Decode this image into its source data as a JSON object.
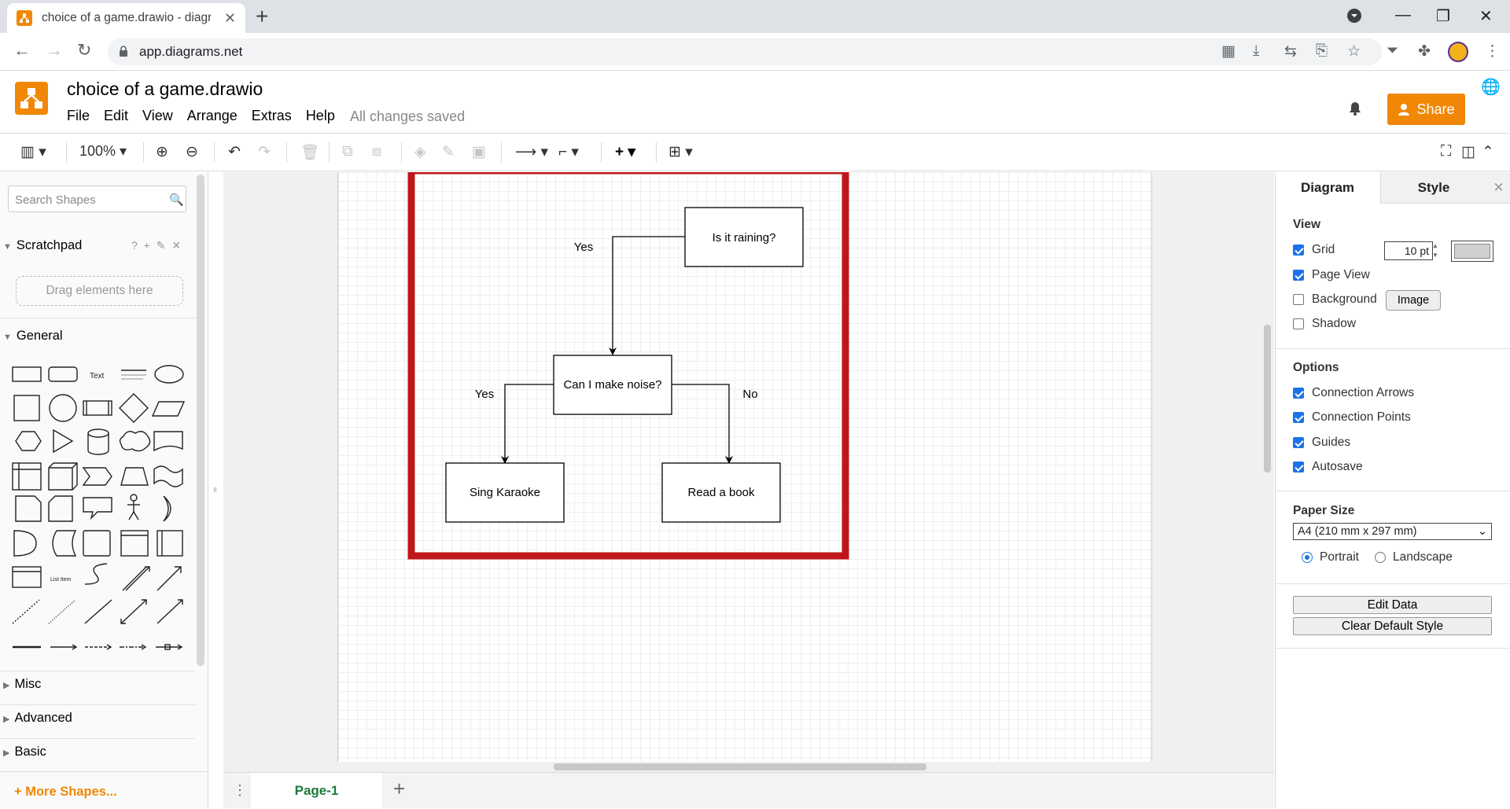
{
  "browser": {
    "tab_title": "choice of a game.drawio - diagra",
    "url": "app.diagrams.net"
  },
  "app": {
    "doc_title": "choice of a game.drawio",
    "menu": [
      "File",
      "Edit",
      "View",
      "Arrange",
      "Extras",
      "Help"
    ],
    "status": "All changes saved",
    "share_label": "Share",
    "accent_color": "#f08705"
  },
  "toolbar": {
    "zoom": "100%"
  },
  "left_panel": {
    "search_placeholder": "Search Shapes",
    "scratchpad": "Scratchpad",
    "scratchpad_tools": "? + ✎ ✕",
    "drag_hint": "Drag elements here",
    "general": "General",
    "misc": "Misc",
    "advanced": "Advanced",
    "basic": "Basic",
    "more_shapes": "+ More Shapes..."
  },
  "diagram": {
    "nodes": [
      {
        "id": "q1",
        "label": "Is it raining?"
      },
      {
        "id": "q2",
        "label": "Can I make noise?"
      },
      {
        "id": "a1",
        "label": "Sing Karaoke"
      },
      {
        "id": "a2",
        "label": "Read a book"
      }
    ],
    "edges": [
      {
        "from": "q1",
        "to": "q2",
        "label": "Yes"
      },
      {
        "from": "q2",
        "to": "a1",
        "label": "Yes"
      },
      {
        "from": "q2",
        "to": "a2",
        "label": "No"
      }
    ],
    "highlight_color": "#c0161b"
  },
  "page_tabs": [
    "Page-1"
  ],
  "right_panel": {
    "tabs": [
      "Diagram",
      "Style"
    ],
    "view_title": "View",
    "grid_label": "Grid",
    "grid_size": "10 pt",
    "page_view_label": "Page View",
    "background_label": "Background",
    "image_button": "Image",
    "shadow_label": "Shadow",
    "options_title": "Options",
    "options": [
      "Connection Arrows",
      "Connection Points",
      "Guides",
      "Autosave"
    ],
    "paper_size_title": "Paper Size",
    "paper_size": "A4 (210 mm x 297 mm)",
    "portrait": "Portrait",
    "landscape": "Landscape",
    "edit_data": "Edit Data",
    "clear_style": "Clear Default Style",
    "checks": {
      "grid": true,
      "page_view": true,
      "background": false,
      "shadow": false
    }
  }
}
